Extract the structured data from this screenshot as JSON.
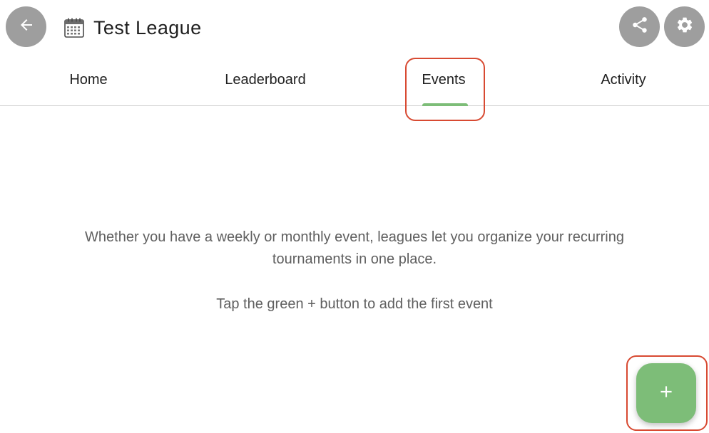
{
  "header": {
    "title": "Test League",
    "back_icon": "arrow-left-icon",
    "title_icon": "calendar-icon",
    "share_icon": "share-icon",
    "settings_icon": "gear-icon"
  },
  "tabs": [
    {
      "label": "Home",
      "selected": false
    },
    {
      "label": "Leaderboard",
      "selected": false
    },
    {
      "label": "Events",
      "selected": true
    },
    {
      "label": "Activity",
      "selected": false
    }
  ],
  "empty_state": {
    "message": "Whether you have a weekly or monthly event, leagues let you organize your recurring tournaments in one place.",
    "hint": "Tap the green + button to add the first event"
  },
  "fab": {
    "icon": "plus-icon"
  },
  "colors": {
    "accent_green": "#7dbd78",
    "button_gray": "#9e9e9e",
    "highlight_red": "#d84a32"
  }
}
